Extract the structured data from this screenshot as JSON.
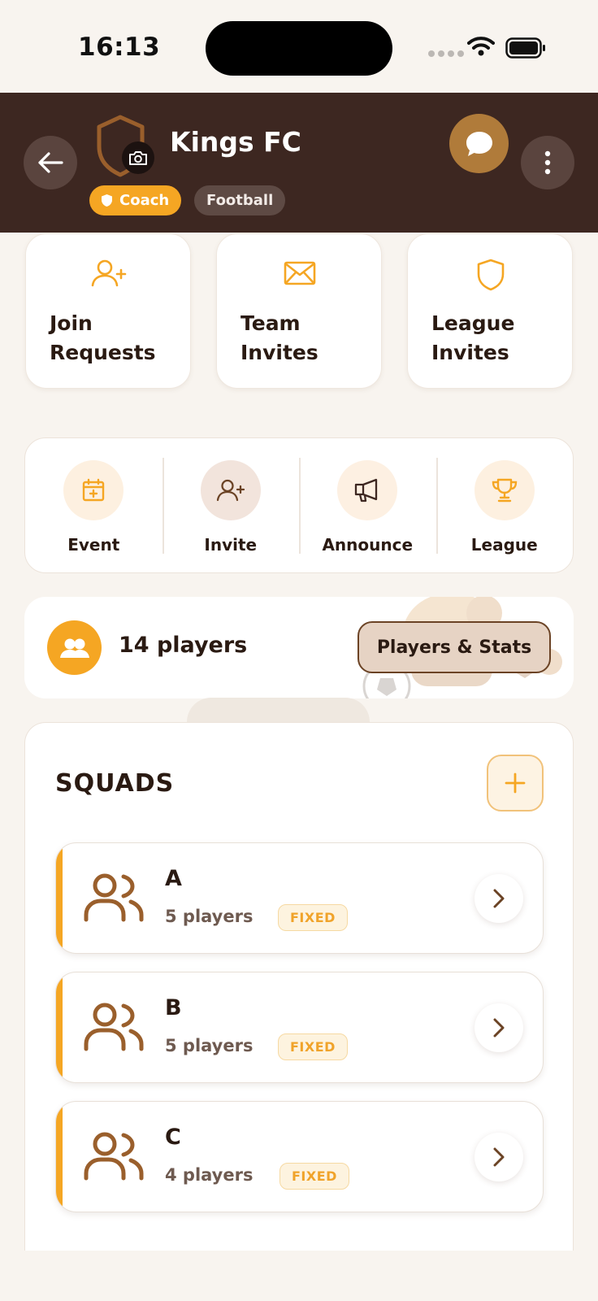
{
  "status_bar": {
    "time": "16:13"
  },
  "header": {
    "team_name": "Kings FC",
    "role_badge": "Coach",
    "sport_badge": "Football"
  },
  "requests": [
    {
      "label": "Join Requests",
      "icon": "user-plus-icon"
    },
    {
      "label": "Team Invites",
      "icon": "envelope-icon"
    },
    {
      "label": "League Invites",
      "icon": "shield-icon"
    }
  ],
  "actions": [
    {
      "label": "Event",
      "icon": "calendar-plus-icon"
    },
    {
      "label": "Invite",
      "icon": "user-plus-icon"
    },
    {
      "label": "Announce",
      "icon": "megaphone-icon"
    },
    {
      "label": "League",
      "icon": "trophy-icon"
    }
  ],
  "players": {
    "count_label": "14 players",
    "button_label": "Players & Stats"
  },
  "squads": {
    "title": "SQUADS",
    "items": [
      {
        "name": "A",
        "count": "5 players",
        "tag": "FIXED"
      },
      {
        "name": "B",
        "count": "5 players",
        "tag": "FIXED"
      },
      {
        "name": "C",
        "count": "4 players",
        "tag": "FIXED"
      }
    ]
  },
  "colors": {
    "header_bg": "#3d2721",
    "accent": "#f5a623",
    "brown": "#9a5f2c",
    "page_bg": "#f8f4ef"
  }
}
